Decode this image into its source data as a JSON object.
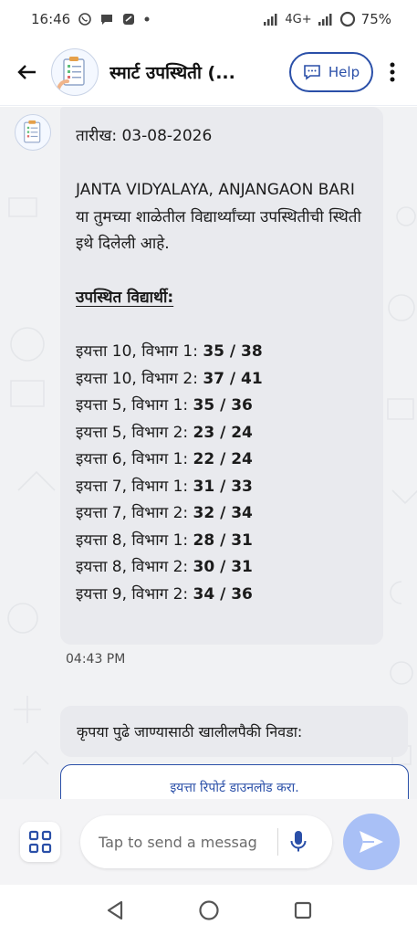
{
  "status_bar": {
    "time": "16:46",
    "network": "4G+",
    "battery": "75%",
    "icons": [
      "whatsapp-icon",
      "chat-icon",
      "app-icon",
      "dot-icon",
      "signal-icon",
      "battery-icon"
    ]
  },
  "header": {
    "title": "स्मार्ट उपस्थिती (...",
    "help_label": "Help"
  },
  "message": {
    "date_line": "तारीख: 03-08-2026",
    "intro_bold": "JANTA VIDYALAYA, ANJANGAON BARI",
    "intro_rest": " या तुमच्या शाळेतील विद्यार्थ्यांच्या उपस्थितीची स्थिती इथे दिलेली आहे.",
    "section_heading": "उपस्थित विद्यार्थी:",
    "rows": [
      {
        "label": "इयत्ता 10, विभाग 1: ",
        "count": "35 / 38"
      },
      {
        "label": "इयत्ता 10, विभाग 2: ",
        "count": "37 / 41"
      },
      {
        "label": "इयत्ता 5, विभाग 1: ",
        "count": "35 / 36"
      },
      {
        "label": "इयत्ता 5, विभाग 2: ",
        "count": "23 / 24"
      },
      {
        "label": "इयत्ता 6, विभाग 1: ",
        "count": "22 / 24"
      },
      {
        "label": "इयत्ता 7, विभाग 1: ",
        "count": "31 / 33"
      },
      {
        "label": "इयत्ता 7, विभाग 2: ",
        "count": "32 / 34"
      },
      {
        "label": "इयत्ता 8, विभाग 1: ",
        "count": "28 / 31"
      },
      {
        "label": "इयत्ता 8, विभाग 2: ",
        "count": "30 / 31"
      },
      {
        "label": "इयत्ता 9, विभाग 2: ",
        "count": "34 / 36"
      }
    ],
    "timestamp": "04:43 PM"
  },
  "prompt": {
    "text": "कृपया पुढे जाण्यासाठी खालीलपैकी निवडा:",
    "action_label": "इयत्ता रिपोर्ट डाउनलोड करा."
  },
  "input": {
    "placeholder": "Tap to send a messag"
  },
  "colors": {
    "accent": "#2a4fa8",
    "send": "#a9c0f6",
    "bubble": "#e9eaee",
    "chat_bg": "#f1f2f4"
  }
}
